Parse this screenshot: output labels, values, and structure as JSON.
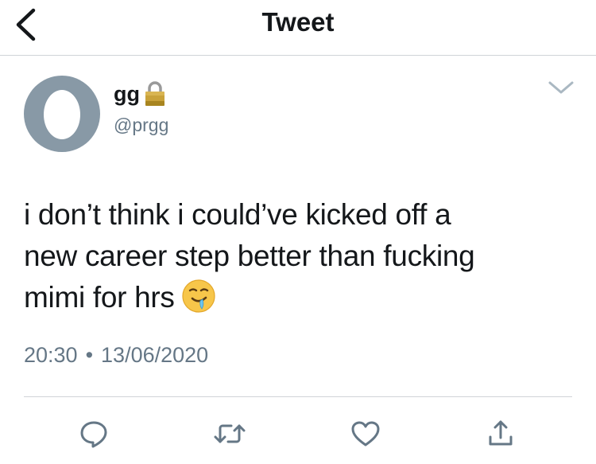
{
  "header": {
    "title": "Tweet",
    "back_icon": "chevron-left-icon"
  },
  "tweet": {
    "author": {
      "display_name": "gg",
      "handle": "@prgg",
      "protected_icon": "lock-icon",
      "avatar_color": "#8899a6"
    },
    "text_lines": [
      "i don’t think i could’ve kicked off a",
      "new career step better than fucking",
      "mimi for hrs"
    ],
    "emoji_icon": "drooling-face-icon",
    "time": "20:30",
    "separator": "•",
    "date": "13/06/2020",
    "menu_icon": "chevron-down-icon"
  },
  "actions": [
    {
      "icon": "reply-icon"
    },
    {
      "icon": "retweet-icon"
    },
    {
      "icon": "like-icon"
    },
    {
      "icon": "share-icon"
    }
  ],
  "colors": {
    "text": "#14171a",
    "secondary": "#657786",
    "icon": "#657786",
    "divider": "#d0d4d8"
  }
}
